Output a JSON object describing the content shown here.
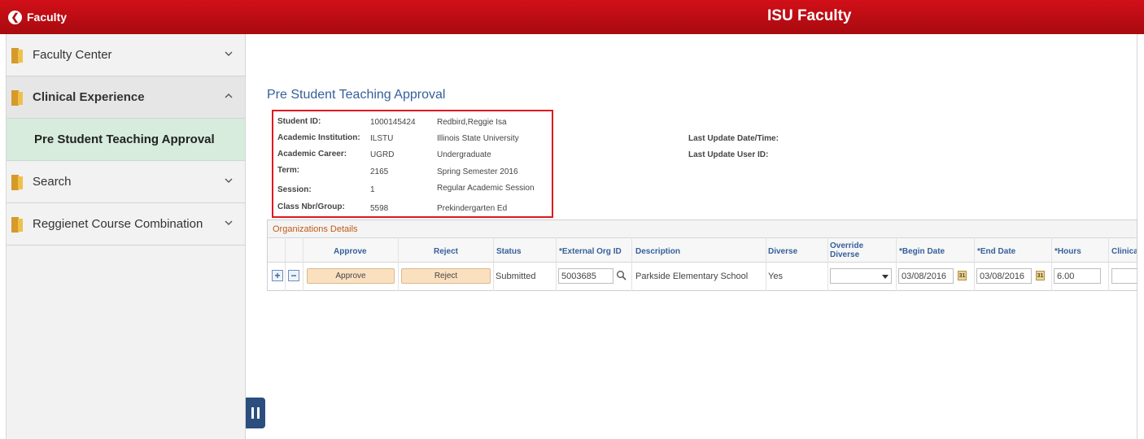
{
  "header": {
    "back_label": "Faculty",
    "title": "ISU Faculty"
  },
  "sidebar": {
    "items": [
      {
        "label": "Faculty Center"
      },
      {
        "label": "Clinical Experience"
      },
      {
        "label": "Pre Student Teaching Approval"
      },
      {
        "label": "Search"
      },
      {
        "label": "Reggienet Course Combination"
      }
    ]
  },
  "page": {
    "title": "Pre Student Teaching Approval"
  },
  "info": {
    "student_id_label": "Student ID:",
    "student_id": "1000145424",
    "student_name": "Redbird,Reggie Isa",
    "institution_label": "Academic Institution:",
    "institution_code": "ILSTU",
    "institution_name": "Illinois State University",
    "career_label": "Academic Career:",
    "career_code": "UGRD",
    "career_name": "Undergraduate",
    "term_label": "Term:",
    "term_code": "2165",
    "term_name": "Spring Semester 2016",
    "session_label": "Session:",
    "session_code": "1",
    "session_name": "Regular Academic Session",
    "class_label": "Class Nbr/Group:",
    "class_code": "5598",
    "class_name": "Prekindergarten Ed",
    "last_update_dt_label": "Last Update Date/Time:",
    "last_update_user_label": "Last Update User ID:"
  },
  "grid": {
    "title": "Organizations Details",
    "headers": {
      "approve": "Approve",
      "reject": "Reject",
      "status": "Status",
      "ext_org": "*External Org ID",
      "description": "Description",
      "diverse": "Diverse",
      "override_diverse": "Override Diverse",
      "begin_date": "*Begin Date",
      "end_date": "*End Date",
      "hours": "*Hours",
      "clinical": "Clinical"
    },
    "row": {
      "add_label": "+",
      "remove_label": "−",
      "approve_btn": "Approve",
      "reject_btn": "Reject",
      "status": "Submitted",
      "ext_org_id": "5003685",
      "description": "Parkside Elementary School",
      "diverse": "Yes",
      "override_diverse": "",
      "begin_date": "03/08/2016",
      "end_date": "03/08/2016",
      "hours": "6.00",
      "clinical": ""
    }
  },
  "icons": {
    "calendar_glyph": "31"
  },
  "colors": {
    "brand_red": "#c0101a",
    "selected_green": "#d7ecdc",
    "link_blue": "#35609b",
    "highlight_box": "#e01820"
  }
}
